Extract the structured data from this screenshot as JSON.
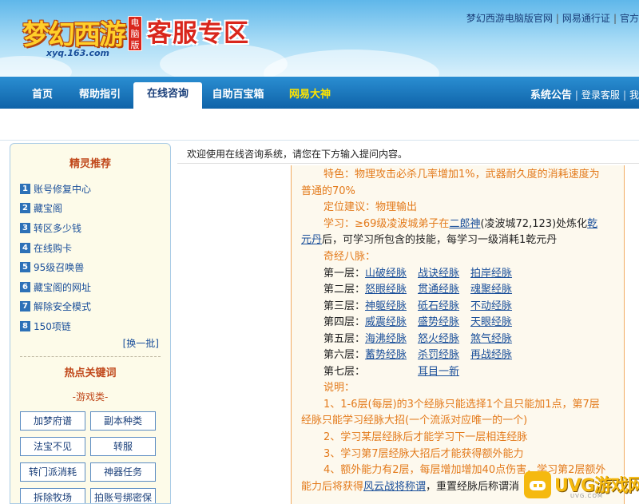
{
  "header": {
    "logo_text": "梦幻西游",
    "logo_badge": "电脑版",
    "logo_url": "xyq.163.com",
    "page_title": "客服专区",
    "top_links": [
      "梦幻西游电脑版官网",
      "网易通行证",
      "官方"
    ]
  },
  "nav": {
    "items": [
      "首页",
      "帮助指引",
      "在线咨询",
      "自助百宝箱",
      "网易大神"
    ],
    "right": [
      "系统公告",
      "登录客服",
      "我"
    ]
  },
  "sidebar": {
    "recommend_title": "精灵推荐",
    "recommend": [
      {
        "num": "1",
        "label": "账号修复中心"
      },
      {
        "num": "2",
        "label": "藏宝阁"
      },
      {
        "num": "3",
        "label": "转区多少钱"
      },
      {
        "num": "4",
        "label": "在线购卡"
      },
      {
        "num": "5",
        "label": "95级召唤兽"
      },
      {
        "num": "6",
        "label": "藏宝阁的网址"
      },
      {
        "num": "7",
        "label": "解除安全模式"
      },
      {
        "num": "8",
        "label": "150项链"
      }
    ],
    "swap_label": "[换一批]",
    "hot_title": "热点关键词",
    "category_label": "-游戏类-",
    "keywords": [
      "加梦府谱",
      "副本种类",
      "法宝不见",
      "转服",
      "转门派消耗",
      "神器任务",
      "拆除牧场",
      "拍账号绑密保"
    ]
  },
  "main": {
    "welcome": "欢迎使用在线咨询系统，请您在下方输入提问内容。",
    "feature_line1": "特色：物理攻击必杀几率增加1%，武器耐久度的消耗速度为",
    "feature_line2": "普通的70%",
    "position": "定位建议：物理输出",
    "learn_prefix": "学习：≥69级凌波城弟子在",
    "learn_npc": "二郎神",
    "learn_loc": "(凌波城72,123)处炼化",
    "learn_item1": "乾",
    "learn_item2": "元丹",
    "learn_suffix": "后，可学习所包含的技能，每学习一级消耗1乾元丹",
    "jingmai_title": "奇经八脉：",
    "layers": [
      {
        "label": "第一层：",
        "links": [
          "山破经脉",
          "战诀经脉",
          "拍岸经脉"
        ]
      },
      {
        "label": "第二层：",
        "links": [
          "怒眼经脉",
          "贯通经脉",
          "魂聚经脉"
        ]
      },
      {
        "label": "第三层：",
        "links": [
          "神躯经脉",
          "砥石经脉",
          "不动经脉"
        ]
      },
      {
        "label": "第四层：",
        "links": [
          "威震经脉",
          "盛势经脉",
          "天眼经脉"
        ]
      },
      {
        "label": "第五层：",
        "links": [
          "海沸经脉",
          "怒火经脉",
          "煞气经脉"
        ]
      },
      {
        "label": "第六层：",
        "links": [
          "蓄势经脉",
          "杀罚经脉",
          "再战经脉"
        ]
      },
      {
        "label": "第七层：",
        "links": [
          "耳目一新"
        ]
      }
    ],
    "notes_title": "说明：",
    "note1a": "1、1-6层(每层)的3个经脉只能选择1个且只能加1点，第7层",
    "note1b": "经脉只能学习经脉大招(一个流派对应唯一的一个)",
    "note2": "2、学习某层经脉后才能学习下一层相连经脉",
    "note3": "3、学习第7层经脉大招后才能获得额外能力",
    "note4": "4、额外能力有2层，每层增加增加40点伤害，学习第2层额外",
    "note5_prefix": "能力后将获得",
    "note5_link": "风云战将称谓",
    "note5_suffix": "，重置经脉后称谓消"
  },
  "watermark": {
    "text": "UVG游戏网",
    "sub": "UVG.COM"
  },
  "colors": {
    "nav_blue": "#1a6fb5",
    "title_red": "#d9261c",
    "content_orange": "#e37a1b",
    "link_blue": "#1a4f9a"
  }
}
